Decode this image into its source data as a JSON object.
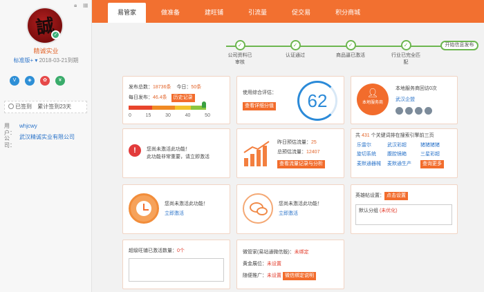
{
  "sidebar": {
    "shop_name": "精诚实业",
    "version": "标准版+",
    "expire": "2018-03-21到期",
    "cert_icons": [
      {
        "name": "vip",
        "glyph": "V",
        "color": "#2e8fd6"
      },
      {
        "name": "shield",
        "glyph": "◈",
        "color": "#2e8fd6"
      },
      {
        "name": "medal",
        "glyph": "✿",
        "color": "#e64949"
      },
      {
        "name": "yen",
        "glyph": "¥",
        "color": "#3aac6b"
      }
    ],
    "signed": "已签到",
    "signed_days": "累计签到23天",
    "user_label": "用户：",
    "user_value": "whjcwy",
    "company_label": "公司：",
    "company_value": "武汉精诚实业有限公司"
  },
  "nav": {
    "tabs": [
      "易管家",
      "做准备",
      "建旺铺",
      "引流量",
      "促交易",
      "积分商城"
    ]
  },
  "progress": {
    "steps": [
      "公司资料已审核",
      "认证通过",
      "商品逼已激活",
      "行业已完全匹配"
    ],
    "end_label": "开始信息发布"
  },
  "publish": {
    "total_label": "发布总数：",
    "total": "18736条",
    "today_label": "今日：",
    "today": "50条",
    "daily_label": "每日发布：",
    "daily": "46.4条",
    "history_btn": "历史记录",
    "scale": [
      "0",
      "15",
      "30",
      "40",
      "50"
    ]
  },
  "score": {
    "label": "使用综合评估：",
    "value": "62",
    "detail_btn": "查看详细分值"
  },
  "service": {
    "label": "本地服务商回访0次",
    "company": "武汉企盟",
    "badge": "本地服务商"
  },
  "activate1": {
    "line1": "您尚未激活此功能！",
    "line2": "此功能非常重要，请立即激活"
  },
  "traffic": {
    "yesterday_label": "昨日预估流量：",
    "yesterday": "25",
    "total_label": "总预估流量：",
    "total": "12407",
    "btn": "查看流量记录与分析"
  },
  "keywords": {
    "head1": "共",
    "count": "431",
    "head2": "个关键词排在搜索引擎前三页",
    "words": [
      "乐雷尔",
      "武汉彩超",
      "猪猪猪猪",
      "旋切系统",
      "腹腔镜箱",
      "三星彩超",
      "麦默通器械",
      "麦默通生产"
    ],
    "more_btn": "查询更多"
  },
  "activate2": {
    "line1": "您尚未激活此功能！",
    "link": "立即激活"
  },
  "activate3": {
    "line1": "您尚未激活此功能！",
    "link": "立即激活"
  },
  "group": {
    "label": "英雄帖设置：",
    "btn": "点击设置",
    "default": "默认分组",
    "status": "(未优化)"
  },
  "wangpu": {
    "label": "超级旺铺已激活数量：",
    "count": "0个"
  },
  "wechat": {
    "label": "微管家(易站通微信版)：",
    "status": "未绑定",
    "ad_label": "黄金展位：",
    "ad_status": "未设置",
    "promo_label": "随便推广：",
    "promo_status": "未设置",
    "bind_btn": "微信绑定说明"
  }
}
